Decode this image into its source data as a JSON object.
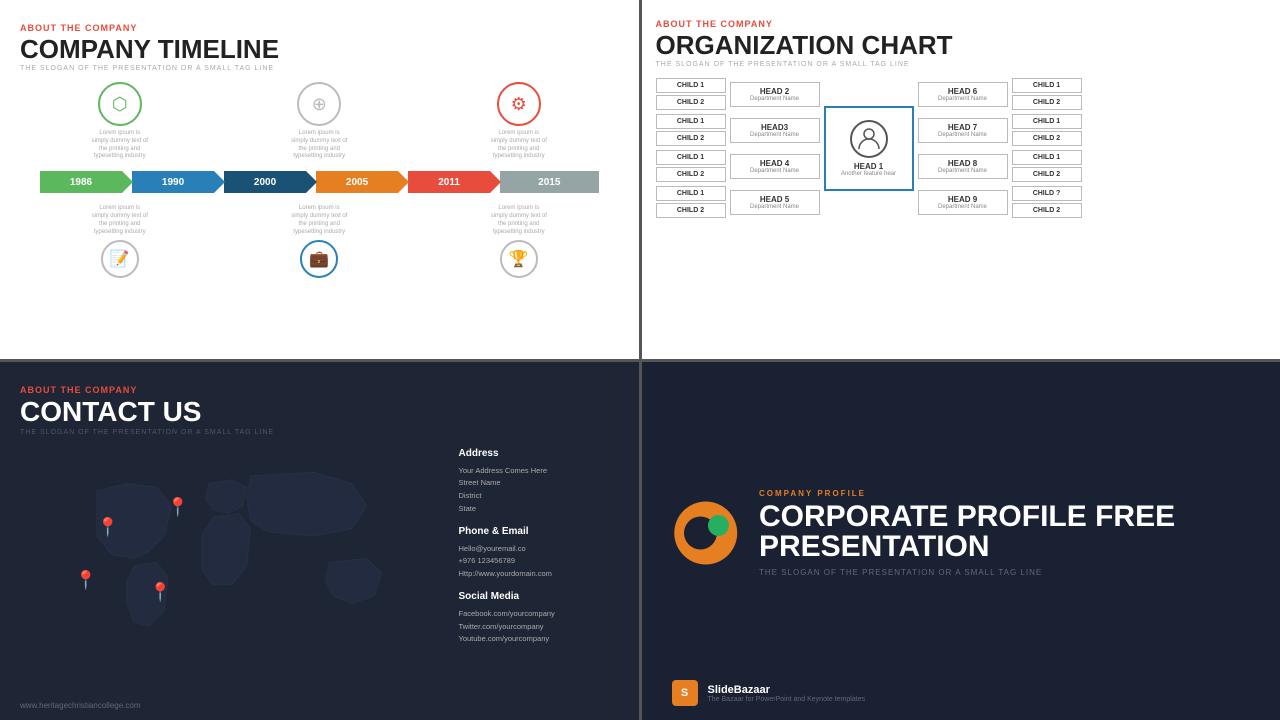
{
  "panels": {
    "timeline": {
      "about": "ABOUT THE COMPANY",
      "title": "COMPANY TIMELINE",
      "tagline": "THE SLOGAN OF THE PRESENTATION OR A SMALL TAG LINE",
      "years": [
        "1986",
        "1990",
        "2000",
        "2005",
        "2011",
        "2015"
      ],
      "icon_text": "Lorem ipsum is simply dummy text of the printing and typesetting industry.",
      "icons_top": [
        "📦",
        "🗄",
        "⚙"
      ],
      "icons_bottom": [
        "✏",
        "💼",
        "🏆"
      ]
    },
    "org": {
      "about": "ABOUT THE COMPANY",
      "title": "ORGANIZATION CHART",
      "tagline": "THE SLOGAN OF THE PRESENTATION OR A SMALL TAG LINE",
      "center": {
        "name": "HEAD 1",
        "desc": "Another feature hear"
      },
      "left_heads": [
        {
          "name": "HEAD 2",
          "dept": "Department Name"
        },
        {
          "name": "HEAD3",
          "dept": "Department Name"
        },
        {
          "name": "HEAD 4",
          "dept": "Department Name"
        },
        {
          "name": "HEAD 5",
          "dept": "Department Name"
        }
      ],
      "right_heads": [
        {
          "name": "HEAD 6",
          "dept": "Department Name"
        },
        {
          "name": "HEAD 7",
          "dept": "Department Name"
        },
        {
          "name": "HEAD 8",
          "dept": "Department Name"
        },
        {
          "name": "HEAD 9",
          "dept": "Department Name"
        }
      ],
      "child1": "CHILD 1",
      "child2": "CHILD 2",
      "child_q": "CHILD ?"
    },
    "contact": {
      "about": "ABOUT THE COMPANY",
      "title": "CONTACT US",
      "tagline": "THE SLOGAN OF THE PRESENTATION OR A SMALL TAG LINE",
      "address_title": "Address",
      "address_lines": [
        "Your Address Comes Here",
        "Street Name",
        "District",
        "State"
      ],
      "phone_title": "Phone & Email",
      "phone_lines": [
        "Hello@youremail.co",
        "+976 123456789",
        "Http://www.yourdomain.com"
      ],
      "social_title": "Social Media",
      "social_lines": [
        "Facebook.com/yourcompany",
        "Twitter.com/yourcompany",
        "Youtube.com/yourcompany"
      ],
      "website": "www.heritagechristiancollege.com"
    },
    "corporate": {
      "company_profile": "COMPANY PROFILE",
      "title": "CORPORATE PROFILE FREE PRESENTATION",
      "tagline": "THE SLOGAN OF THE PRESENTATION OR A SMALL TAG LINE",
      "sb_name": "SlideBazaar",
      "sb_sub": "The Bazaar for PowerPoint and Keynote templates",
      "sb_initial": "S"
    }
  }
}
